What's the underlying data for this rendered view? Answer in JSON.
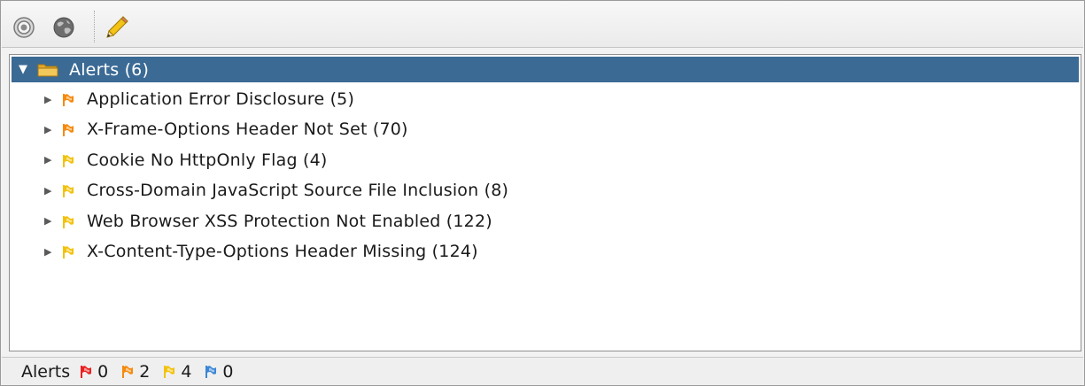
{
  "toolbar": {
    "buttons": [
      {
        "name": "target-icon"
      },
      {
        "name": "globe-icon"
      },
      {
        "name": "pencil-icon"
      }
    ]
  },
  "tree": {
    "root": {
      "label": "Alerts (6)",
      "expanded": true,
      "icon": "folder-icon"
    },
    "items": [
      {
        "label": "Application Error Disclosure (5)",
        "risk": "medium",
        "flag_color": "#f58a0b"
      },
      {
        "label": "X-Frame-Options Header Not Set (70)",
        "risk": "medium",
        "flag_color": "#f58a0b"
      },
      {
        "label": "Cookie No HttpOnly Flag (4)",
        "risk": "low",
        "flag_color": "#f2c20d"
      },
      {
        "label": "Cross-Domain JavaScript Source File Inclusion (8)",
        "risk": "low",
        "flag_color": "#f2c20d"
      },
      {
        "label": "Web Browser XSS Protection Not Enabled (122)",
        "risk": "low",
        "flag_color": "#f2c20d"
      },
      {
        "label": "X-Content-Type-Options Header Missing (124)",
        "risk": "low",
        "flag_color": "#f2c20d"
      }
    ]
  },
  "status": {
    "label": "Alerts",
    "counts": [
      {
        "risk": "high",
        "value": "0",
        "flag_color": "#e8211f"
      },
      {
        "risk": "medium",
        "value": "2",
        "flag_color": "#f58a0b"
      },
      {
        "risk": "low",
        "value": "4",
        "flag_color": "#f2c20d"
      },
      {
        "risk": "informational",
        "value": "0",
        "flag_color": "#3a86d6"
      }
    ]
  }
}
